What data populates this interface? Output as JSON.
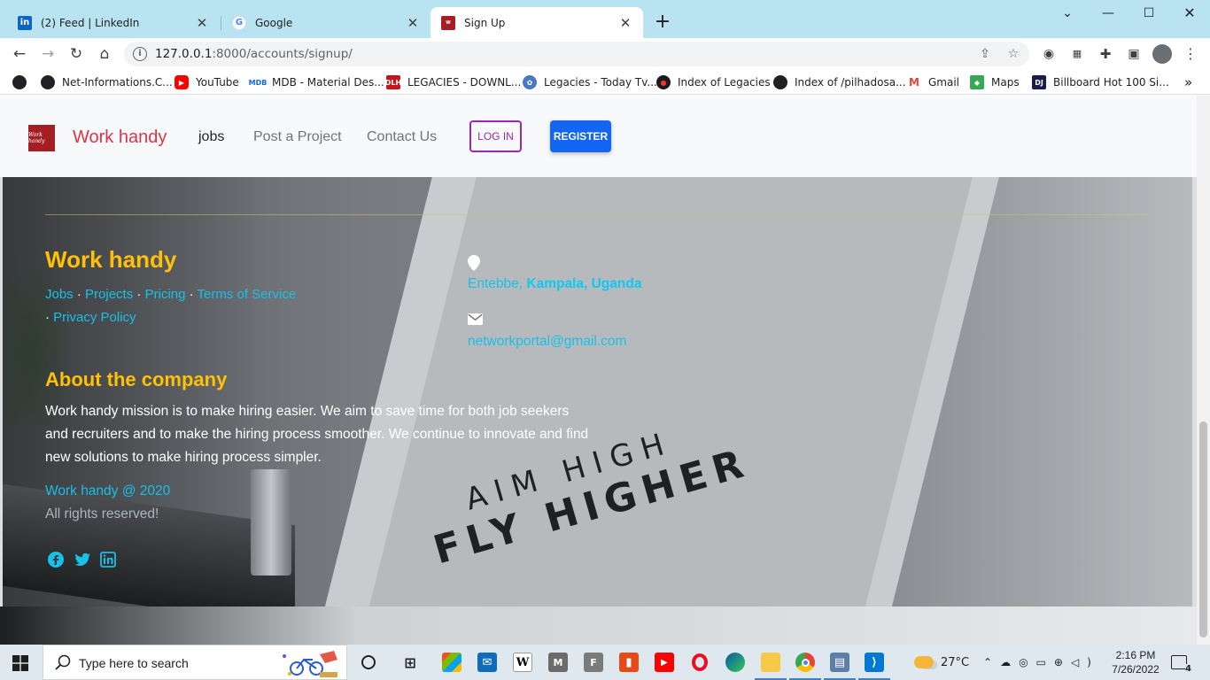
{
  "browser": {
    "tabs": [
      {
        "title": "(2) Feed | LinkedIn",
        "icon": "linkedin-icon",
        "active": false
      },
      {
        "title": "Google",
        "icon": "google-icon",
        "active": false
      },
      {
        "title": "Sign Up",
        "icon": "site-favicon",
        "active": true
      }
    ],
    "url_host": "127.0.0.1",
    "url_rest": ":8000/accounts/signup/",
    "bookmarks": [
      {
        "label": "",
        "icon": "globe-icon"
      },
      {
        "label": "Net-Informations.C...",
        "icon": "globe-icon"
      },
      {
        "label": "YouTube",
        "icon": "youtube-icon"
      },
      {
        "label": "MDB - Material Des...",
        "icon": "mdb-icon"
      },
      {
        "label": "LEGACIES - DOWNL...",
        "icon": "dlh-icon"
      },
      {
        "label": "Legacies - Today Tv...",
        "icon": "tv-icon"
      },
      {
        "label": "Index of Legacies",
        "icon": "legacies-icon"
      },
      {
        "label": "Index of /pilhadosa...",
        "icon": "globe-icon"
      },
      {
        "label": "Gmail",
        "icon": "gmail-icon"
      },
      {
        "label": "Maps",
        "icon": "maps-icon"
      },
      {
        "label": "Billboard Hot 100 Si...",
        "icon": "dj-icon"
      }
    ],
    "more_bookmarks": "»"
  },
  "navbar": {
    "brand": "Work handy",
    "logo_text": "Work handy",
    "links": [
      "jobs",
      "Post a Project",
      "Contact Us"
    ],
    "login_label": "LOG IN",
    "register_label": "REGISTER"
  },
  "footer": {
    "brand": "Work handy",
    "links": [
      "Jobs",
      "Projects",
      "Pricing",
      "Terms of Service",
      "Privacy Policy"
    ],
    "separator": "·",
    "about_title": "About the company",
    "about_text": "Work handy mission is to make hiring easier. We aim to save time for both job seekers and recruiters and to make the hiring process smoother. We continue to innovate and find new solutions to make hiring process simpler.",
    "copyright": "Work handy @ 2020",
    "rights": "All rights reserved!",
    "address_city": "Entebbe,",
    "address_region": "Kampala, Uganda",
    "email": "networkportal@gmail.com",
    "poster_line1": "AIM HIGH",
    "poster_line2": "FLY HIGHER",
    "colors": {
      "heading": "#ffc107",
      "link": "#17c1e8"
    }
  },
  "taskbar": {
    "search_placeholder": "Type here to search",
    "weather": "27°C",
    "time": "2:16 PM",
    "date": "7/26/2022",
    "notifications": "4"
  }
}
